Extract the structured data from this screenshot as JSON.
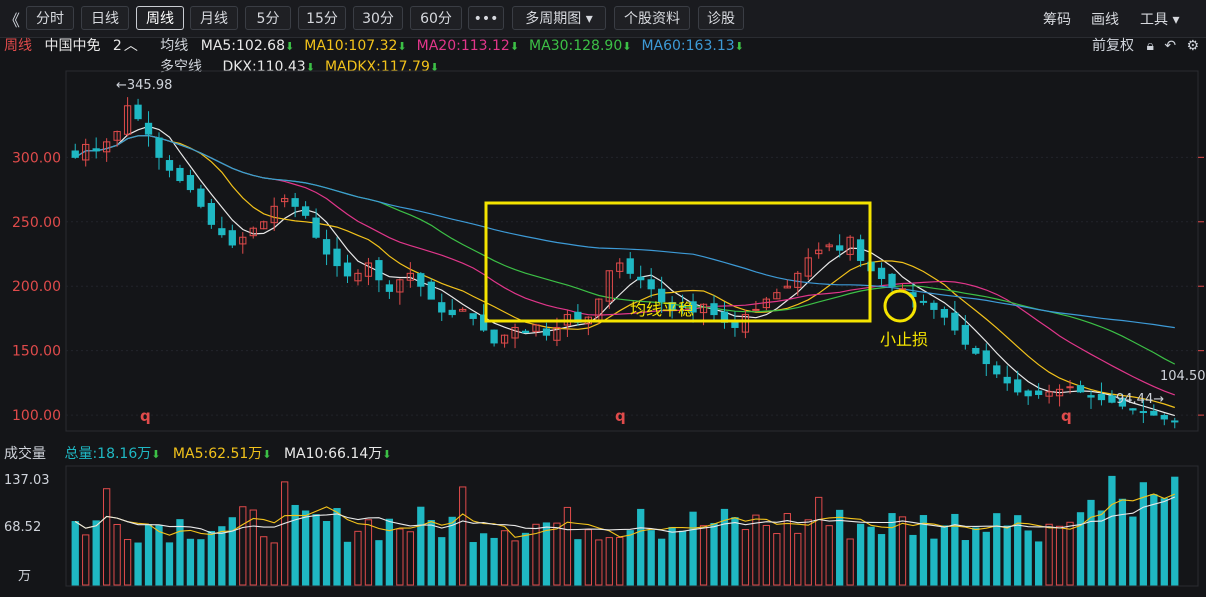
{
  "toolbar": {
    "back_icon": "double-chevron-left-icon",
    "tabs": [
      "分时",
      "日线",
      "周线",
      "月线",
      "5分",
      "15分",
      "30分",
      "60分"
    ],
    "active_tab": "周线",
    "more_label": "•••",
    "multi_period_label": "多周期图 ▾",
    "stock_info_label": "个股资料",
    "diagnosis_label": "诊股",
    "right": {
      "chips": "筹码",
      "draw": "画线",
      "tools": "工具 ▾"
    }
  },
  "header": {
    "period": "周线",
    "stock_name": "中国中免",
    "count_label": "2",
    "ma_group_label": "均线",
    "ma": [
      {
        "label": "MA5:102.68",
        "color": "#e8e8e8"
      },
      {
        "label": "MA10:107.32",
        "color": "#f2c21b"
      },
      {
        "label": "MA20:113.12",
        "color": "#e0368a"
      },
      {
        "label": "MA30:128.90",
        "color": "#3cc046"
      },
      {
        "label": "MA60:163.13",
        "color": "#3d9ad6"
      }
    ],
    "fuquan_label": "前复权",
    "dkx_group_label": "多空线",
    "dkx": [
      {
        "label": "DKX:110.43",
        "color": "#e8e8e8"
      },
      {
        "label": "MADKX:117.79",
        "color": "#f2c21b"
      }
    ]
  },
  "annotations": {
    "high_label": "←345.98",
    "low_label": "94.44→",
    "last_label": "104.50",
    "box_text": "均线平稳",
    "circle_text": "小止损",
    "q_markers": [
      "q",
      "q",
      "q"
    ]
  },
  "volume": {
    "title": "成交量",
    "total": "总量:18.16万",
    "ma5": "MA5:62.51万",
    "ma10": "MA10:66.14万",
    "y_labels": [
      "137.03",
      "68.52",
      "万"
    ]
  },
  "colors": {
    "up": "#e04b4b",
    "down": "#1fb8c3",
    "ma5": "#e8e8e8",
    "ma10": "#f2c21b",
    "ma20": "#e0368a",
    "ma30": "#3cc046",
    "ma60": "#3d9ad6",
    "axis_label": "#e04b4b",
    "highlight": "#f5e400"
  },
  "chart_data": {
    "type": "candlestick",
    "y_axis_labels": [
      "300.00",
      "250.00",
      "200.00",
      "150.00",
      "100.00"
    ],
    "ylim": [
      90,
      360
    ],
    "high": 345.98,
    "low": 94.44,
    "last": 104.5,
    "weekly_close_trend": [
      300,
      310,
      305,
      312,
      320,
      340,
      330,
      318,
      300,
      290,
      282,
      275,
      262,
      248,
      240,
      232,
      238,
      245,
      250,
      262,
      268,
      262,
      255,
      238,
      225,
      216,
      208,
      210,
      218,
      205,
      196,
      205,
      210,
      200,
      190,
      180,
      178,
      182,
      175,
      166,
      156,
      162,
      168,
      164,
      170,
      162,
      168,
      178,
      172,
      176,
      190,
      212,
      218,
      210,
      205,
      198,
      188,
      182,
      184,
      180,
      186,
      178,
      172,
      168,
      178,
      182,
      190,
      195,
      200,
      210,
      222,
      228,
      232,
      228,
      238,
      220,
      212,
      206,
      200,
      198,
      192,
      188,
      182,
      176,
      166,
      155,
      148,
      140,
      132,
      125,
      118,
      115,
      116,
      118,
      120,
      122,
      118,
      114,
      112,
      110,
      107,
      104,
      102,
      100,
      97,
      95
    ],
    "volume_ylim": [
      0,
      137.03
    ]
  }
}
